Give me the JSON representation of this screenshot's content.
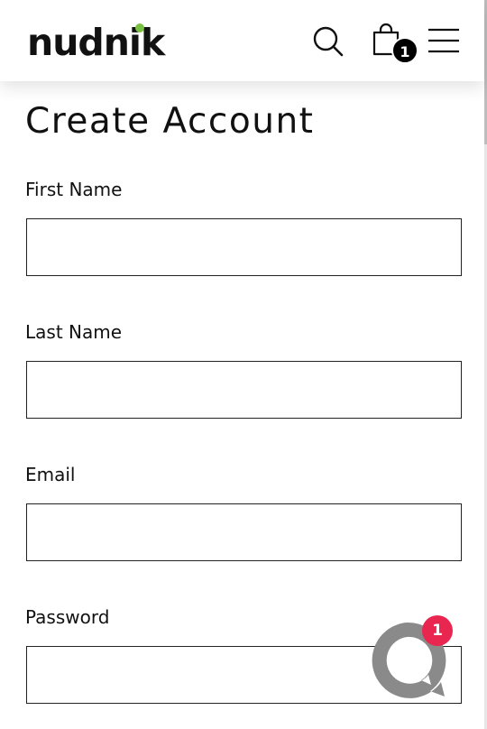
{
  "brand": {
    "logo_text": "nudnik",
    "accent_color": "#7ac143"
  },
  "header": {
    "search_icon": "search-icon",
    "cart_icon": "shopping-bag-icon",
    "cart_count": "1",
    "menu_icon": "hamburger-menu-icon"
  },
  "page": {
    "title": "Create Account"
  },
  "form": {
    "fields": [
      {
        "label": "First Name",
        "value": "",
        "type": "text"
      },
      {
        "label": "Last Name",
        "value": "",
        "type": "text"
      },
      {
        "label": "Email",
        "value": "",
        "type": "email"
      },
      {
        "label": "Password",
        "value": "",
        "type": "password"
      }
    ]
  },
  "chat": {
    "icon": "chat-bubble-icon",
    "badge_count": "1",
    "badge_color": "#e8264f"
  }
}
